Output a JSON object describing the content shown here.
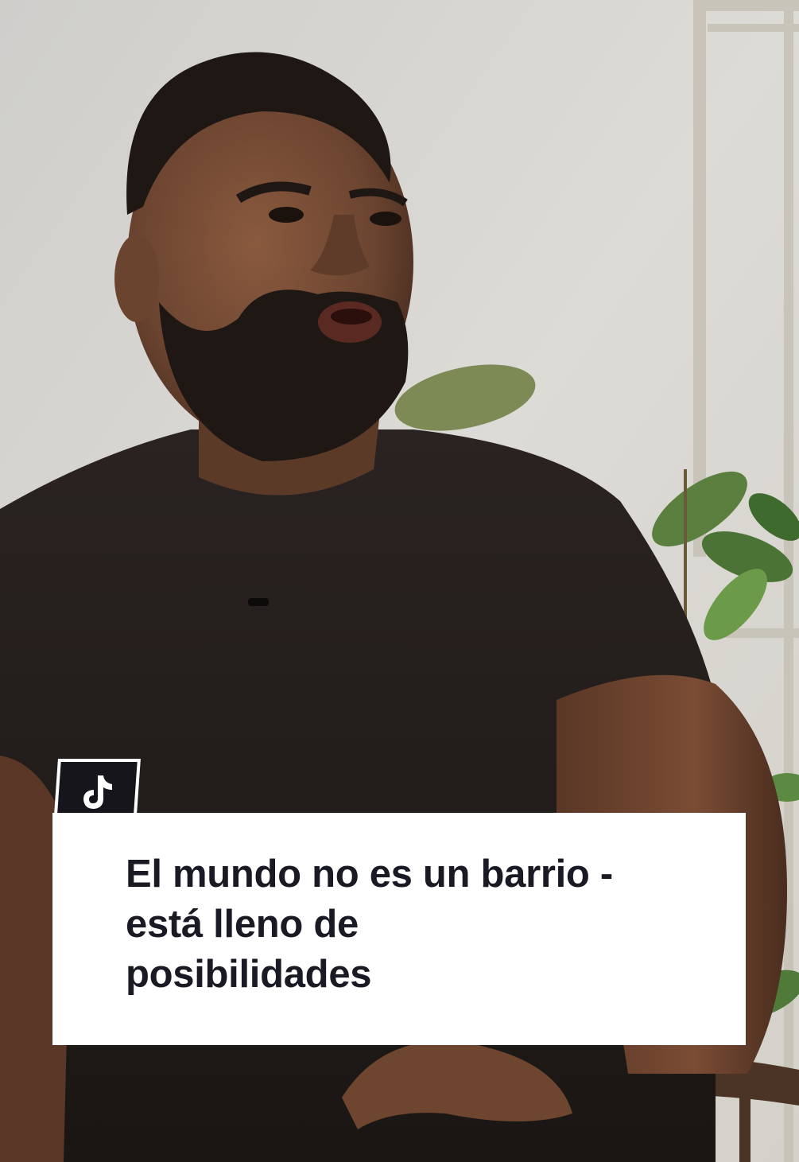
{
  "caption": {
    "lines": [
      "El mundo no es un barrio -",
      "está lleno de",
      "posibilidades"
    ]
  },
  "logo": {
    "icon": "tiktok-note-icon"
  },
  "colors": {
    "card_background": "#ffffff",
    "caption_text": "#1a1a24",
    "logo_background": "#16151c",
    "shirt": "#221d1b",
    "skin": "#6b4430",
    "wall": "#d9d7d2",
    "plant": "#4f7a3a"
  }
}
